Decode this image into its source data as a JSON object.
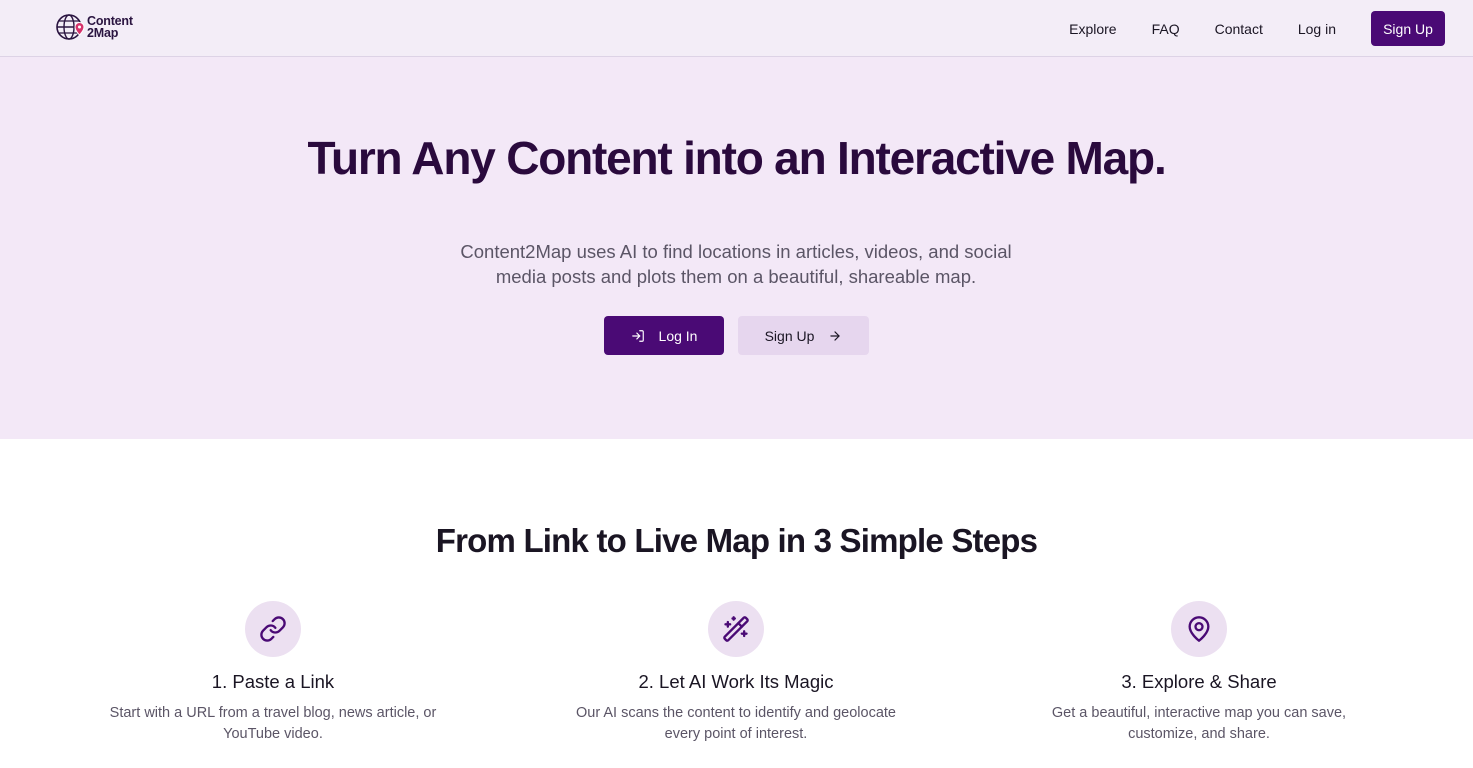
{
  "brand": {
    "line1": "Content",
    "line2": "2Map"
  },
  "nav": {
    "explore": "Explore",
    "faq": "FAQ",
    "contact": "Contact",
    "login": "Log in",
    "signup": "Sign Up"
  },
  "hero": {
    "title": "Turn Any Content into an Interactive Map.",
    "subtitle": "Content2Map uses AI to find locations in articles, videos, and social media posts and plots them on a beautiful, shareable map.",
    "login_label": "Log In",
    "signup_label": "Sign Up"
  },
  "steps": {
    "title": "From Link to Live Map in 3 Simple Steps",
    "items": [
      {
        "icon": "link-icon",
        "title": "1. Paste a Link",
        "desc": "Start with a URL from a travel blog, news article, or YouTube video."
      },
      {
        "icon": "magic-wand-icon",
        "title": "2. Let AI Work Its Magic",
        "desc": "Our AI scans the content to identify and geolocate every point of interest."
      },
      {
        "icon": "map-pin-icon",
        "title": "3. Explore & Share",
        "desc": "Get a beautiful, interactive map you can save, customize, and share."
      }
    ]
  },
  "colors": {
    "accent": "#4a0a75",
    "hero_bg": "#f3e8f7",
    "header_bg": "#f3edf7",
    "icon_bg": "#ece0f1"
  }
}
